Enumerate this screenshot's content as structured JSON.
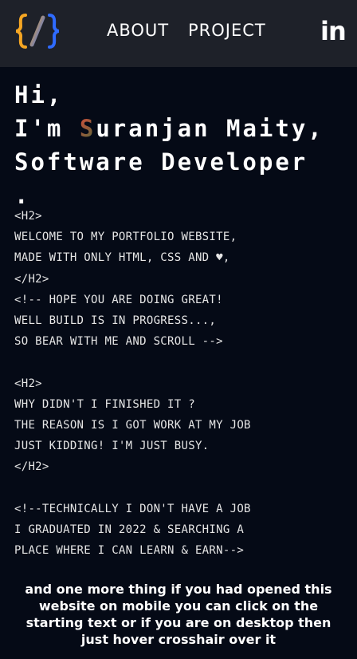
{
  "nav": {
    "logo_icon": "curly-braces-slash-logo",
    "about_label": "ABOUT",
    "project_label": "PROJECT",
    "linkedin_label": "in"
  },
  "hero": {
    "greeting": "Hi,",
    "intro_prefix": "I'm ",
    "name_initial": "S",
    "name_rest": "uranjan Maity,",
    "role": "Software Developer",
    "period": "."
  },
  "code_block": {
    "lines": [
      "<H2>",
      "WELCOME TO MY PORTFOLIO WEBSITE,",
      "MADE WITH ONLY HTML, CSS AND ♥,",
      "</H2>",
      "<!-- HOPE YOU ARE DOING GREAT!",
      "WELL BUILD IS IN PROGRESS...,",
      "SO BEAR WITH ME AND SCROLL -->",
      "",
      "<H2>",
      "WHY DIDN'T I FINISHED IT ?",
      "THE REASON IS I GOT WORK AT MY JOB",
      "JUST KIDDING! I'M JUST BUSY.",
      "</H2>",
      "",
      "<!--TECHNICALLY I DON'T HAVE A JOB",
      "I GRADUATED IN 2022 & SEARCHING A",
      "PLACE WHERE I CAN LEARN & EARN-->"
    ]
  },
  "footer_note": "and one more thing if you had opened this website on mobile you can click on the starting text or if you are on desktop then just hover crosshair over it",
  "colors": {
    "background": "#050a16",
    "navbar": "#1e2129",
    "logo_orange": "#f5a623",
    "logo_blue": "#2f6bff",
    "name_accent_start": "#d94d3a",
    "name_accent_end": "#4b6b3a"
  }
}
